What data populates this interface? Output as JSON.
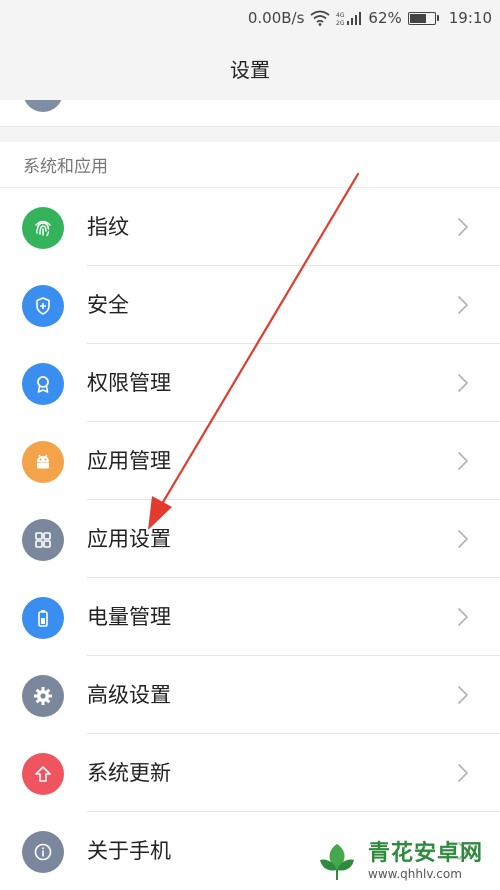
{
  "status_bar": {
    "speed": "0.00B/s",
    "network": "4G\n2G",
    "battery_percent": "62%",
    "battery_level": 0.62,
    "time": "19:10"
  },
  "title": "设置",
  "section": {
    "header": "系统和应用",
    "items": [
      {
        "label": "指纹",
        "icon": "fingerprint-icon",
        "color": "#34b35a"
      },
      {
        "label": "安全",
        "icon": "shield-icon",
        "color": "#3a8ef0"
      },
      {
        "label": "权限管理",
        "icon": "permission-badge-icon",
        "color": "#3a8ef0"
      },
      {
        "label": "应用管理",
        "icon": "android-icon",
        "color": "#f5a34b"
      },
      {
        "label": "应用设置",
        "icon": "grid-icon",
        "color": "#7a879c"
      },
      {
        "label": "电量管理",
        "icon": "battery-icon",
        "color": "#3a8ef0"
      },
      {
        "label": "高级设置",
        "icon": "gear-icon",
        "color": "#7a879c"
      },
      {
        "label": "系统更新",
        "icon": "upload-arrow-icon",
        "color": "#f0545e"
      },
      {
        "label": "关于手机",
        "icon": "info-icon",
        "color": "#7a879c"
      }
    ]
  },
  "annotation": {
    "color": "#e53a2e"
  },
  "watermark": {
    "title": "青花安卓网",
    "url": "www.qhhlv.com"
  }
}
